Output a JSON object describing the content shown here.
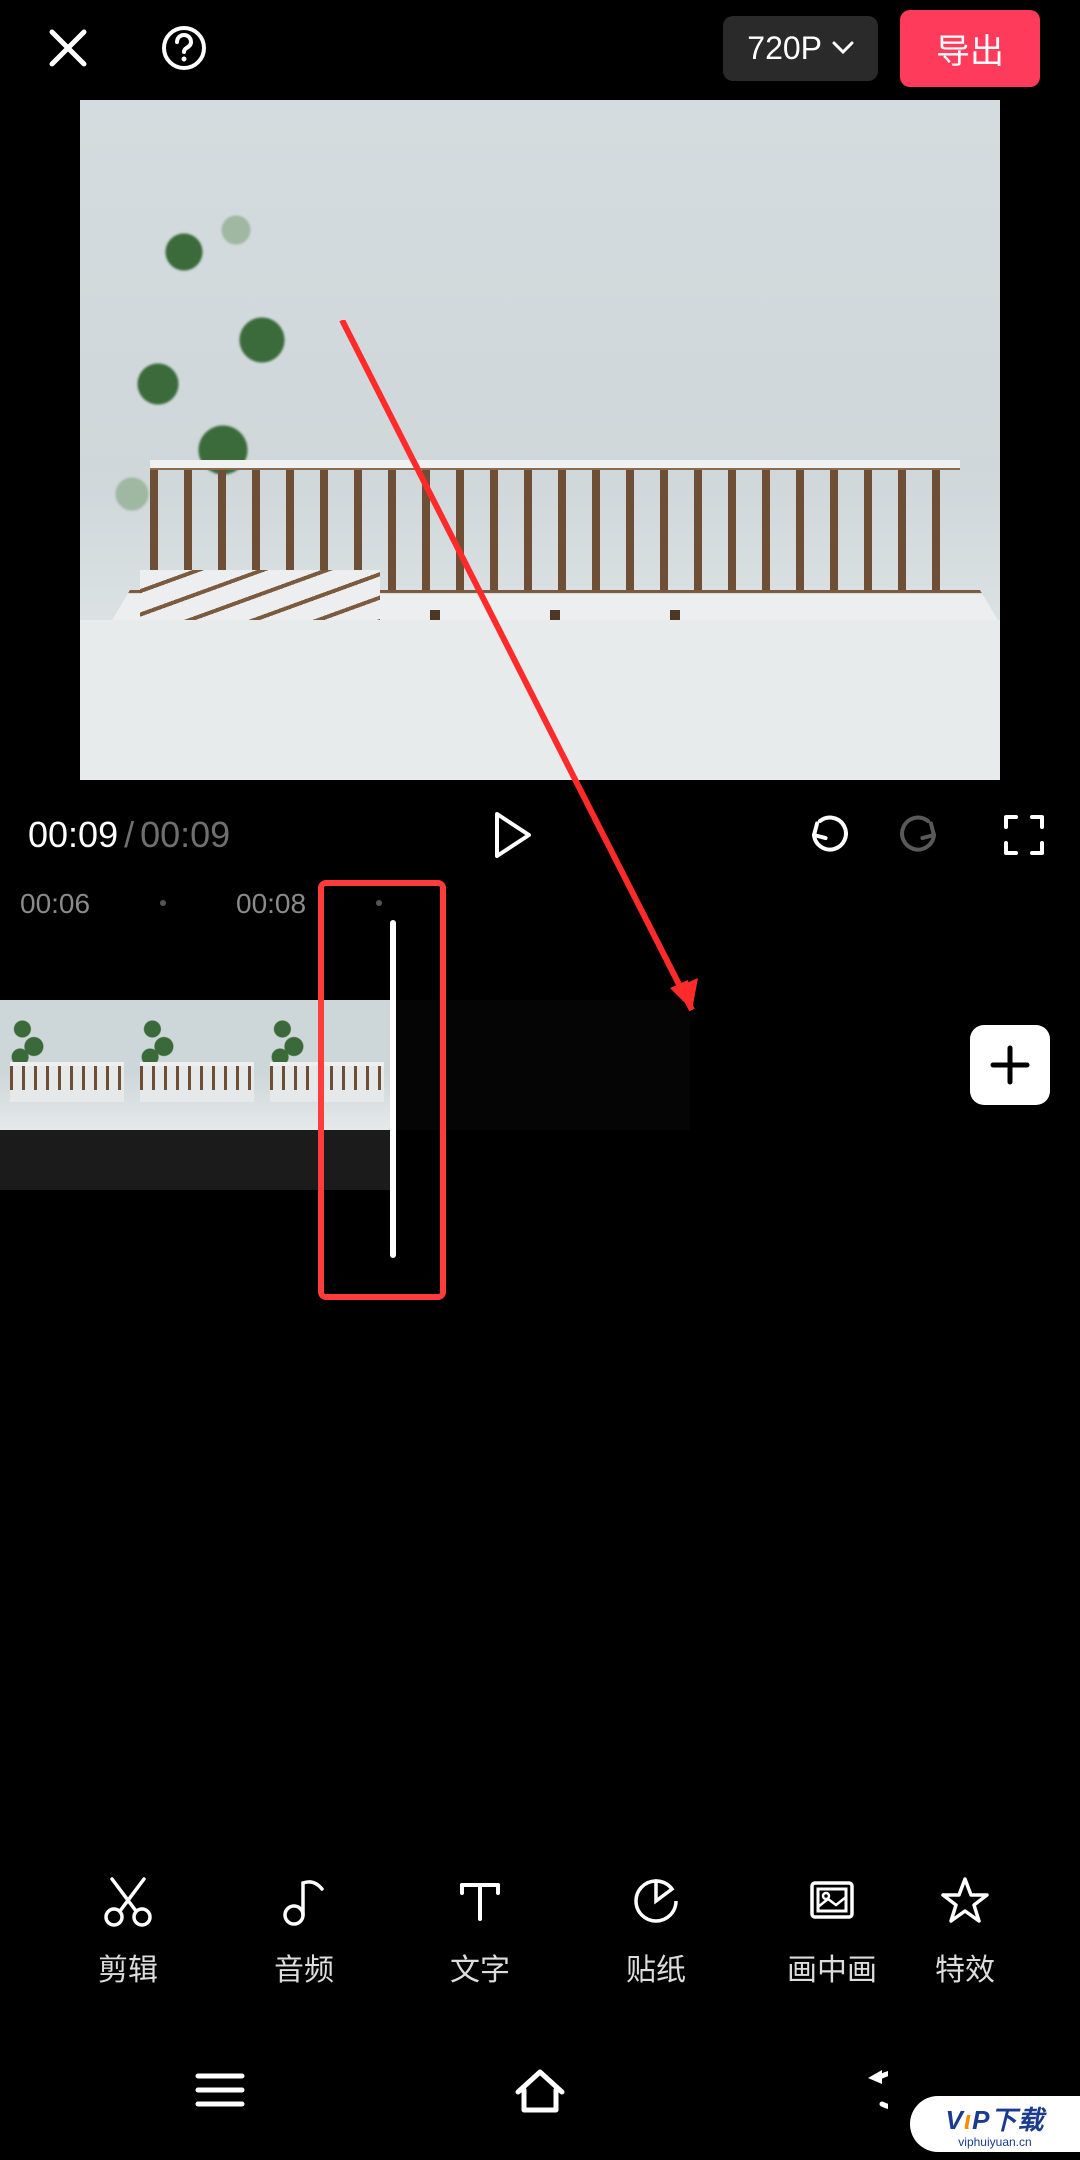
{
  "topbar": {
    "resolution_label": "720P",
    "export_label": "导出"
  },
  "playback": {
    "current": "00:09",
    "duration": "00:09"
  },
  "ruler": {
    "marks": [
      "00:06",
      "00:08"
    ]
  },
  "toolbar": {
    "items": [
      {
        "key": "cut",
        "label": "剪辑"
      },
      {
        "key": "audio",
        "label": "音频"
      },
      {
        "key": "text",
        "label": "文字"
      },
      {
        "key": "sticker",
        "label": "贴纸"
      },
      {
        "key": "pip",
        "label": "画中画"
      },
      {
        "key": "fx",
        "label": "特效"
      }
    ]
  },
  "watermark": {
    "brand": "VIP下载",
    "url": "viphuiyuan.cn"
  }
}
